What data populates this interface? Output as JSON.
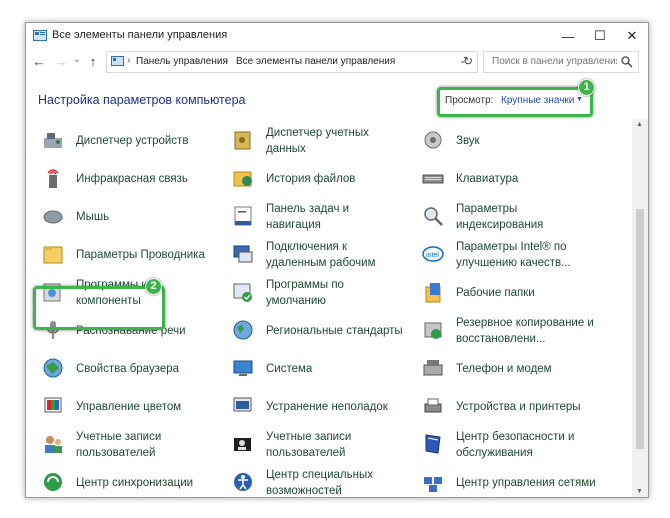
{
  "window": {
    "title": "Все элементы панели управления",
    "minimize": "—",
    "maximize": "☐",
    "close": "✕"
  },
  "nav": {
    "back": "←",
    "forward": "→",
    "recent": "⌄",
    "up": "↑",
    "breadcrumb": [
      "Панель управления",
      "Все элементы панели управления"
    ],
    "separator": "›",
    "refresh": "↻",
    "search_placeholder": "Поиск в панели управления"
  },
  "heading": "Настройка параметров компьютера",
  "view_by": {
    "label": "Просмотр:",
    "value": "Крупные значки",
    "caret": "▼"
  },
  "annotations": [
    "1",
    "2"
  ],
  "accent_color": "#3cb54a",
  "items": [
    {
      "label": "Диспетчер устройств",
      "icon": "device-manager-icon"
    },
    {
      "label": "Диспетчер учетных\nданных",
      "icon": "credential-manager-icon"
    },
    {
      "label": "Звук",
      "icon": "sound-icon"
    },
    {
      "label": "Инфракрасная связь",
      "icon": "infrared-icon"
    },
    {
      "label": "История файлов",
      "icon": "file-history-icon"
    },
    {
      "label": "Клавиатура",
      "icon": "keyboard-icon"
    },
    {
      "label": "Мышь",
      "icon": "mouse-icon"
    },
    {
      "label": "Панель задач и\nнавигация",
      "icon": "taskbar-icon"
    },
    {
      "label": "Параметры\nиндексирования",
      "icon": "indexing-icon"
    },
    {
      "label": "Параметры Проводника",
      "icon": "explorer-options-icon"
    },
    {
      "label": "Подключения к\nудаленным рабочим",
      "icon": "remote-desktop-icon"
    },
    {
      "label": "Параметры Intel® по\nулучшению качеств...",
      "icon": "intel-icon"
    },
    {
      "label": "Программы и\nкомпоненты",
      "icon": "programs-icon"
    },
    {
      "label": "Программы по\nумолчанию",
      "icon": "default-programs-icon"
    },
    {
      "label": "Рабочие папки",
      "icon": "work-folders-icon"
    },
    {
      "label": "Распознавание речи",
      "icon": "speech-recognition-icon"
    },
    {
      "label": "Региональные стандарты",
      "icon": "region-icon"
    },
    {
      "label": "Резервное копирование и\nвосстановлени...",
      "icon": "backup-icon"
    },
    {
      "label": "Свойства браузера",
      "icon": "internet-options-icon"
    },
    {
      "label": "Система",
      "icon": "system-icon"
    },
    {
      "label": "Телефон и модем",
      "icon": "phone-modem-icon"
    },
    {
      "label": "Управление цветом",
      "icon": "color-management-icon"
    },
    {
      "label": "Устранение неполадок",
      "icon": "troubleshooting-icon"
    },
    {
      "label": "Устройства и принтеры",
      "icon": "devices-printers-icon"
    },
    {
      "label": "Учетные записи\nпользователей",
      "icon": "user-accounts-icon"
    },
    {
      "label": "Учетные записи\nпользователей",
      "icon": "user-accounts-2-icon"
    },
    {
      "label": "Центр безопасности и\nобслуживания",
      "icon": "security-center-icon"
    },
    {
      "label": "Центр синхронизации",
      "icon": "sync-center-icon"
    },
    {
      "label": "Центр специальных\nвозможностей",
      "icon": "accessibility-icon"
    },
    {
      "label": "Центр управления сетями",
      "icon": "network-center-icon"
    }
  ]
}
